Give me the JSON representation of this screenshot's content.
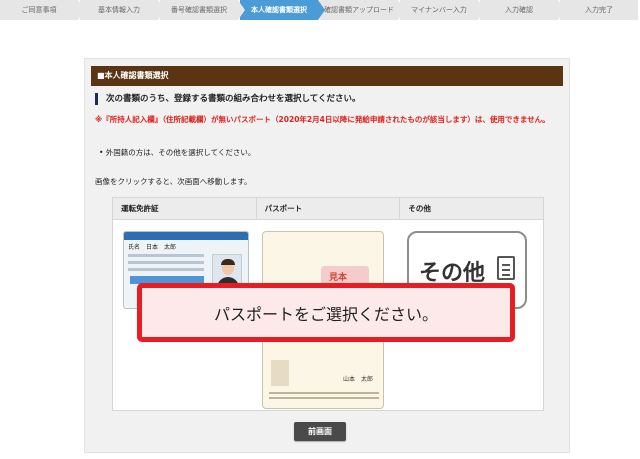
{
  "steps": [
    {
      "label": "ご同意事項",
      "active": false
    },
    {
      "label": "基本情報入力",
      "active": false
    },
    {
      "label": "番号確認書類選択",
      "active": false
    },
    {
      "label": "本人確認書類選択",
      "active": true
    },
    {
      "label": "確認書類アップロード",
      "active": false
    },
    {
      "label": "マイナンバー入力",
      "active": false
    },
    {
      "label": "入力確認",
      "active": false
    },
    {
      "label": "入力完了",
      "active": false
    }
  ],
  "panel": {
    "title": "■本人確認書類選択",
    "lead": "次の書類のうち、登録する書類の組み合わせを選択してください。",
    "warning": "※『所持人記入欄』（住所記載欄）が無いパスポート（2020年2月4日以降に発給申請されたものが該当します）は、使用できません。",
    "note": "• 外国籍の方は、その他を選択してください。",
    "instruction": "画像をクリックすると、次画面へ移動します。"
  },
  "table": {
    "headers": [
      "運転免許証",
      "パスポート",
      "その他"
    ]
  },
  "license_card": {
    "name_text": "氏名　日本　太郎"
  },
  "passport_card": {
    "stamp_text": "見本",
    "sign_text": "山本　太郎"
  },
  "other_card": {
    "label": "その他"
  },
  "callout": {
    "text": "パスポートをご選択ください。"
  },
  "back_button": {
    "label": "前画面"
  },
  "colors": {
    "active_step": "#4a9bd6",
    "panel_header": "#5b3414",
    "warning_text": "#e0201b",
    "callout_border": "#e81d22",
    "callout_bg": "#fde9ea"
  }
}
